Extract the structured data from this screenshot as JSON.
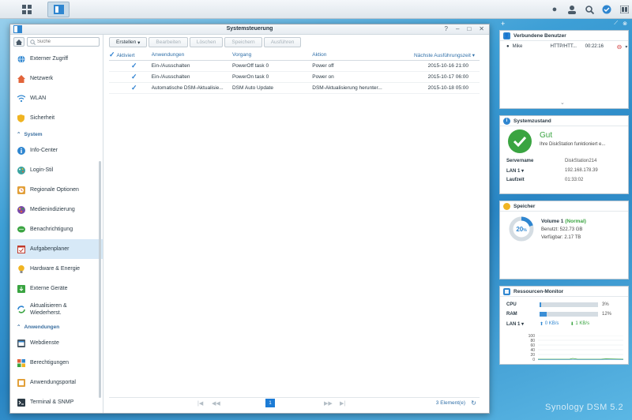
{
  "window": {
    "title": "Systemsteuerung",
    "controls": [
      "?",
      "–",
      "□",
      "✕"
    ]
  },
  "sidebar": {
    "search_placeholder": "Suche",
    "items": [
      {
        "label": "Externer Zugriff",
        "icon": "globe-icon"
      },
      {
        "label": "Netzwerk",
        "icon": "house-network-icon"
      },
      {
        "label": "WLAN",
        "icon": "wifi-icon"
      },
      {
        "label": "Sicherheit",
        "icon": "shield-icon"
      }
    ],
    "section_system": "System",
    "system_items": [
      {
        "label": "Info-Center",
        "icon": "info-icon"
      },
      {
        "label": "Login-Stil",
        "icon": "palette-icon"
      },
      {
        "label": "Regionale Optionen",
        "icon": "clock-icon"
      },
      {
        "label": "Medienindizierung",
        "icon": "media-icon"
      },
      {
        "label": "Benachrichtigung",
        "icon": "chat-icon"
      },
      {
        "label": "Aufgabenplaner",
        "icon": "calendar-icon"
      },
      {
        "label": "Hardware & Energie",
        "icon": "bulb-icon"
      },
      {
        "label": "Externe Geräte",
        "icon": "device-icon"
      },
      {
        "label": "Aktualisieren & Wiederherst.",
        "icon": "update-icon"
      }
    ],
    "section_apps": "Anwendungen",
    "app_items": [
      {
        "label": "Webdienste",
        "icon": "web-icon"
      },
      {
        "label": "Berechtigungen",
        "icon": "grid-icon"
      },
      {
        "label": "Anwendungsportal",
        "icon": "portal-icon"
      },
      {
        "label": "Terminal & SNMP",
        "icon": "terminal-icon"
      }
    ]
  },
  "toolbar": {
    "create": "Erstellen",
    "edit": "Bearbeiten",
    "delete": "Löschen",
    "save": "Speichern",
    "run": "Ausführen"
  },
  "table": {
    "headers": [
      "Aktiviert",
      "Anwendungen",
      "Vorgang",
      "Aktion",
      "Nächste Ausführungszeit"
    ],
    "rows": [
      {
        "app": "Ein-/Ausschalten",
        "task": "PowerOff task 0",
        "action": "Power off",
        "next": "2015-10-16 21:00"
      },
      {
        "app": "Ein-/Ausschalten",
        "task": "PowerOn task 0",
        "action": "Power on",
        "next": "2015-10-17 06:00"
      },
      {
        "app": "Automatische DSM-Aktualisie...",
        "task": "DSM Auto Update",
        "action": "DSM-Aktualisierung herunter...",
        "next": "2015-10-18 05:00"
      }
    ]
  },
  "pager": {
    "page": "1",
    "count": "3 Element(e)"
  },
  "widgets": {
    "users": {
      "title": "Verbundene Benutzer",
      "rows": [
        {
          "name": "Mike",
          "proto": "HTTP/HTT...",
          "time": "00:22:16"
        }
      ]
    },
    "health": {
      "title": "Systemzustand",
      "status": "Gut",
      "message": "Ihre DiskStation funktioniert e...",
      "server_label": "Servername",
      "server_value": "DiskStation214",
      "lan_label": "LAN 1",
      "lan_value": "192.168.178.39",
      "uptime_label": "Laufzeit",
      "uptime_value": "01:33:02"
    },
    "storage": {
      "title": "Speicher",
      "percent": "20",
      "percent_unit": "%",
      "volume": "Volume 1",
      "volume_status": "(Normal)",
      "used": "Benutzt: 522.73 GB",
      "free": "Verfügbar: 2.17 TB"
    },
    "monitor": {
      "title": "Ressourcen-Monitor",
      "cpu_label": "CPU",
      "cpu_value": "3%",
      "cpu_fraction": 0.03,
      "ram_label": "RAM",
      "ram_value": "12%",
      "ram_fraction": 0.12,
      "lan_label": "LAN 1",
      "upload": "0 KB/s",
      "download": "1 KB/s",
      "axis": [
        "100",
        "80",
        "60",
        "40",
        "20",
        "0"
      ]
    }
  },
  "watermark": "Synology DSM 5.2",
  "colors": {
    "accent": "#1c7bd5",
    "ok": "#3aa441"
  }
}
